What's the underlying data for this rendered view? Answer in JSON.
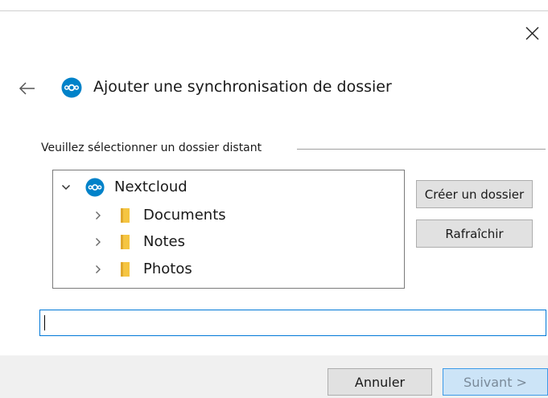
{
  "window": {
    "close_label": "×"
  },
  "header": {
    "back_label": "←",
    "title": "Ajouter une synchronisation de dossier"
  },
  "remote_folder_group": {
    "label": "Veuillez sélectionner un dossier distant"
  },
  "tree": {
    "root": {
      "label": "Nextcloud",
      "expanded": true
    },
    "children": [
      {
        "label": "Documents",
        "expanded": false
      },
      {
        "label": "Notes",
        "expanded": false
      },
      {
        "label": "Photos",
        "expanded": false
      }
    ]
  },
  "actions": {
    "create_folder_label": "Créer un dossier",
    "refresh_label": "Rafraîchir"
  },
  "path_input": {
    "value": "",
    "placeholder": ""
  },
  "footer": {
    "cancel_label": "Annuler",
    "next_label": "Suivant >"
  },
  "colors": {
    "accent": "#0082c9",
    "folder": "#f5c542",
    "focus_border": "#0078d7"
  },
  "icons": {
    "app_logo": "nextcloud-logo-icon",
    "folder": "folder-icon",
    "expand": "chevron-right-icon",
    "collapse": "chevron-down-icon",
    "back": "arrow-left-icon",
    "close": "close-icon"
  }
}
